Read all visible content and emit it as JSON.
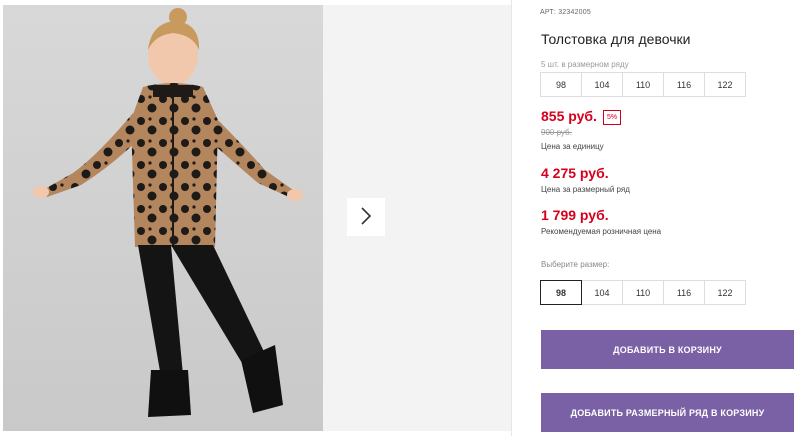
{
  "gallery": {
    "next_icon": "chevron-right-icon"
  },
  "product": {
    "article_label": "АРТ:",
    "article_value": "32342005",
    "title": "Толстовка для девочки",
    "pack_hint": "5 шт. в размерном ряду",
    "pack_sizes": [
      "98",
      "104",
      "110",
      "116",
      "122"
    ],
    "unit_price": "855 руб.",
    "discount": "5%",
    "old_price": "900 руб.",
    "unit_price_label": "Цена за единицу",
    "pack_price": "4 275 руб.",
    "pack_price_label": "Цена за размерный ряд",
    "retail_price": "1 799 руб.",
    "retail_price_label": "Рекомендуемая розничная цена",
    "choose_size_label": "Выберите размер:",
    "size_options": [
      "98",
      "104",
      "110",
      "116",
      "122"
    ],
    "selected_size": "98",
    "add_to_cart": "ДОБАВИТЬ В КОРЗИНУ",
    "add_pack_to_cart": "ДОБАВИТЬ РАЗМЕРНЫЙ РЯД В КОРЗИНУ"
  },
  "colors": {
    "price_red": "#d6001c",
    "button_purple": "#7a61a6"
  }
}
